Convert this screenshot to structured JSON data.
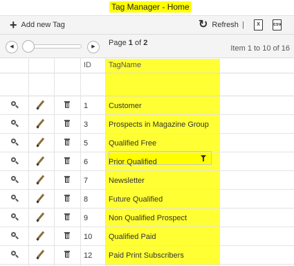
{
  "title": "Tag Manager - Home",
  "toolbar": {
    "add_label": "Add new Tag",
    "refresh_label": "Refresh",
    "separator": "|",
    "export_excel_icon": "excel-export-icon",
    "export_csv_icon": "csv-export-icon"
  },
  "pager": {
    "page_prefix": "Page",
    "current_page": "1",
    "page_of": "of",
    "total_pages": "2",
    "item_info": "Item 1 to 10 of 16"
  },
  "grid": {
    "columns": [
      "",
      "",
      "",
      "ID",
      "TagName"
    ],
    "highlight_color": "#ffff33",
    "filter_value": "",
    "rows": [
      {
        "id": "1",
        "name": "Customer"
      },
      {
        "id": "3",
        "name": "Prospects in Magazine Group"
      },
      {
        "id": "5",
        "name": "Qualified Free"
      },
      {
        "id": "6",
        "name": "Prior Qualified"
      },
      {
        "id": "7",
        "name": "Newsletter"
      },
      {
        "id": "8",
        "name": "Future Qualified"
      },
      {
        "id": "9",
        "name": "Non Qualified Prospect"
      },
      {
        "id": "10",
        "name": "Qualified Paid"
      },
      {
        "id": "12",
        "name": "Paid Print Subscribers"
      }
    ]
  }
}
